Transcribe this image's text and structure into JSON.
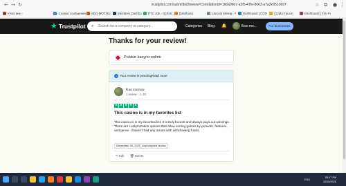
{
  "browser": {
    "url": "trustpilot.com/submitted/review?correlationId=1bba0607-a3f5-47fe-8062-a7a2e9513697",
    "bookmarks": [
      {
        "label": "Участник – профи...",
        "color": "#c0392b"
      },
      {
        "label": "1 новое сообщение",
        "color": "#4a7bd0"
      },
      {
        "label": "SEO-MOT.RU",
        "color": "#d35400"
      },
      {
        "label": "Members Dashboar...",
        "color": "#2c3e50"
      },
      {
        "label": "PTC Job - Gerbrim...",
        "color": "#27ae60"
      },
      {
        "label": "Dashboard",
        "color": "#e67e22"
      },
      {
        "label": "Litecoin Mining - N...",
        "color": "#7f8c8d"
      },
      {
        "label": "Dashboard | COINP...",
        "color": "#2980b9"
      },
      {
        "label": "Crypto Faucet",
        "color": "#f39c12"
      },
      {
        "label": "Dashboard | Fire Fa...",
        "color": "#c0392b"
      }
    ]
  },
  "header": {
    "logo_star": "★",
    "logo_text": "Trustpilot",
    "search_placeholder": "Search for a company or category...",
    "categories": "Categories",
    "blog": "Blog",
    "user_name": "firas mo...",
    "business_button": "For businesses"
  },
  "page": {
    "title": "Thanks for your review!",
    "company_name": "Polskie kasyno online",
    "pending_text": "Your review is pending.",
    "read_more": "Read more",
    "reviewer_name": "firas mornani",
    "reviewer_meta": "1 review  ·  ⊙ JO",
    "rating": 5,
    "review_title": "This casino is in my favorites list",
    "review_body": "This casino is in my favorites list. It is truly honest and always pays out winnings. There are customization options that allow sorting games by provider, features, and genre. I haven't had any issues with withdrawing funds.",
    "review_date": "December 20, 2025",
    "review_badge": "Unprompted review",
    "edit": "✎ Edit",
    "delete": "🗑 Delete"
  },
  "taskbar": {
    "time": "03:17 PM",
    "date": "12/20/2025",
    "lang": "ENG"
  }
}
